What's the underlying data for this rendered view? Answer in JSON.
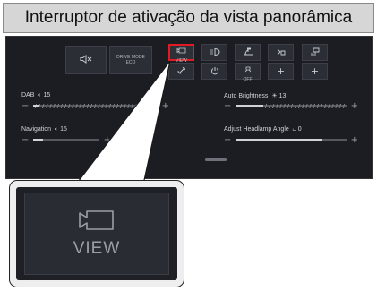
{
  "title": "Interruptor de ativação da vista panorâmica",
  "buttons": {
    "mute_icon": "speaker-muted",
    "drive_mode_line1": "DRIVE MODE",
    "drive_mode_line2": "ECO",
    "view_label": "VIEW",
    "view_icon": "camera",
    "row1_icons": [
      "camera",
      "headlamp-level",
      "wiper",
      "car-parking",
      "seat-heating"
    ],
    "row2_icons": [
      "adas",
      "power",
      "esp-off",
      "add",
      "add"
    ],
    "esp_label": "OFF",
    "add_glyph": "+"
  },
  "sliders": [
    {
      "label": "DAB",
      "icon": "volume-icon",
      "value": "15",
      "level": 0.05
    },
    {
      "label": "Navigation",
      "icon": "volume-icon",
      "value": "15",
      "level": 0.15
    },
    {
      "label": "Auto Brightness",
      "icon": "brightness-icon",
      "value": "13",
      "level": 0.25
    },
    {
      "label": "Adjust Headlamp Angle",
      "icon": "headlamp-icon",
      "value": "0",
      "level": 0.78
    }
  ],
  "slider_minus": "−",
  "slider_plus": "+",
  "zoom": {
    "label": "VIEW",
    "icon": "camera"
  },
  "colors": {
    "highlight": "#e01b24",
    "screen_bg": "#1c1d22",
    "title_bg": "#d6d6d6"
  }
}
